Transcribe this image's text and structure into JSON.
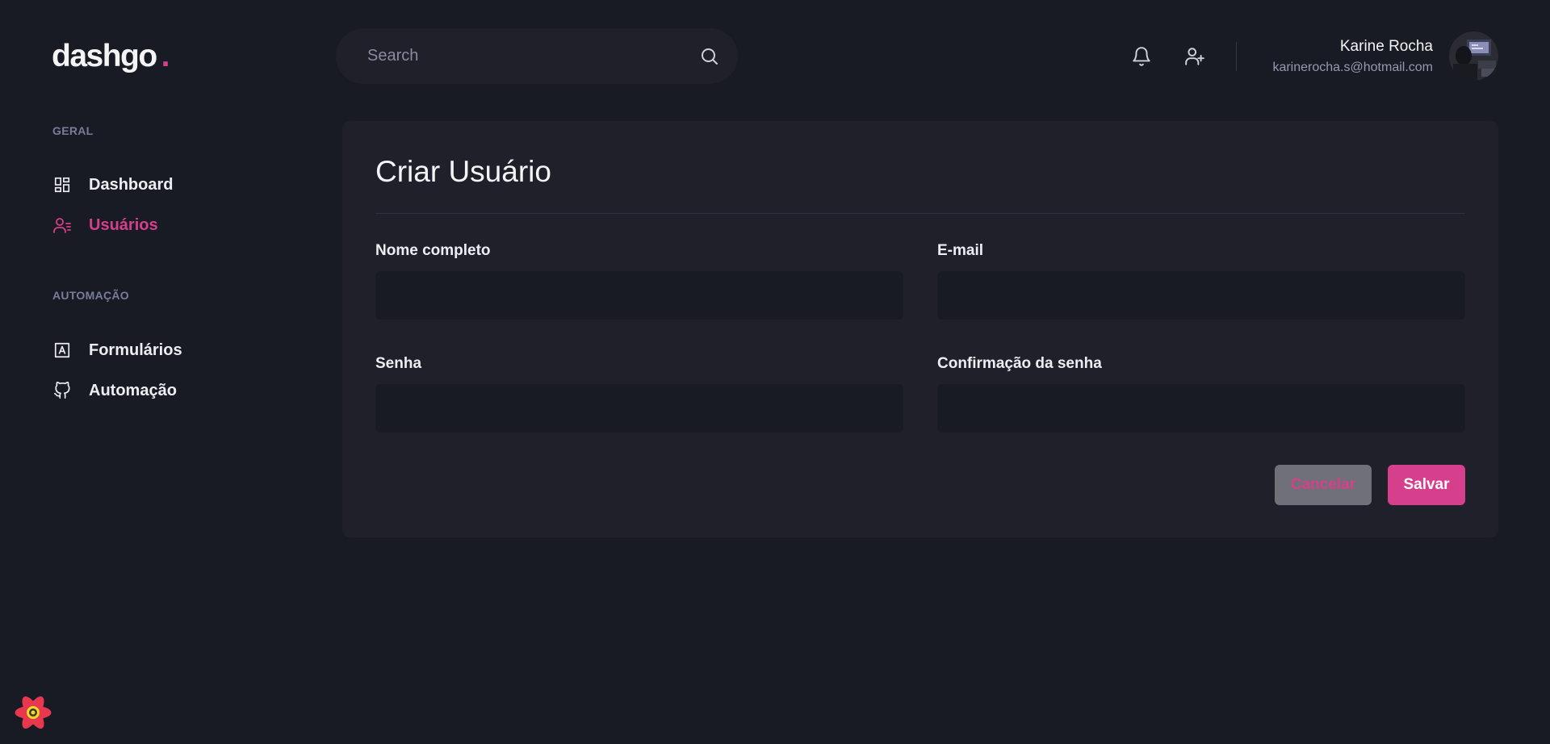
{
  "brand": {
    "name": "dashgo",
    "dot": ".",
    "accent": "#d53f8c"
  },
  "header": {
    "search": {
      "placeholder": "Search",
      "icon": "search-icon"
    },
    "notifications_icon": "bell-icon",
    "add_user_icon": "user-plus-icon",
    "profile": {
      "name": "Karine Rocha",
      "email": "karinerocha.s@hotmail.com"
    }
  },
  "sidebar": {
    "sections": [
      {
        "title": "GERAL",
        "items": [
          {
            "label": "Dashboard",
            "icon": "dashboard-icon",
            "active": false
          },
          {
            "label": "Usuários",
            "icon": "users-icon",
            "active": true
          }
        ]
      },
      {
        "title": "AUTOMAÇÃO",
        "items": [
          {
            "label": "Formulários",
            "icon": "form-icon",
            "active": false
          },
          {
            "label": "Automação",
            "icon": "github-icon",
            "active": false
          }
        ]
      }
    ]
  },
  "form": {
    "title": "Criar Usuário",
    "fields": [
      {
        "label": "Nome completo",
        "value": ""
      },
      {
        "label": "E-mail",
        "value": ""
      },
      {
        "label": "Senha",
        "value": ""
      },
      {
        "label": "Confirmação da senha",
        "value": ""
      }
    ],
    "cancel_label": "Cancelar",
    "save_label": "Salvar"
  },
  "colors": {
    "background": "#181b23",
    "surface": "#1f2029",
    "muted": "#797d9a",
    "cancel_bg": "#707078"
  }
}
